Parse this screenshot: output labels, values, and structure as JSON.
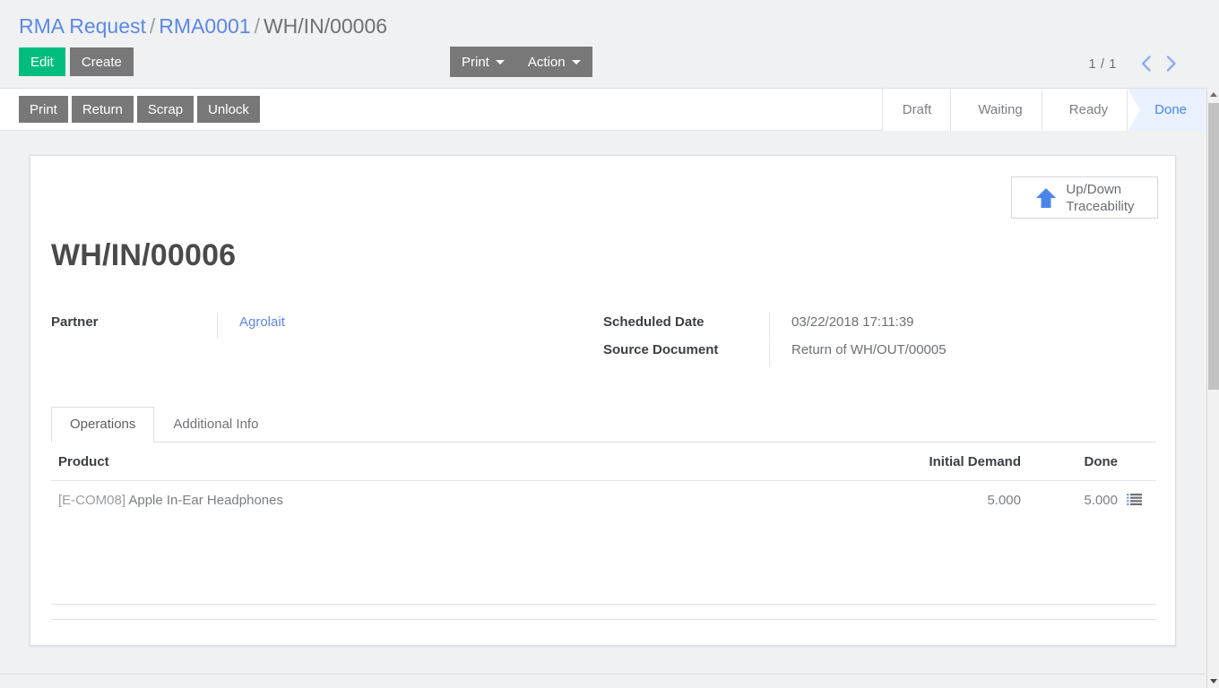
{
  "breadcrumb": {
    "items": [
      {
        "label": "RMA Request",
        "link": true
      },
      {
        "label": "RMA0001",
        "link": true
      },
      {
        "label": "WH/IN/00006",
        "link": false
      }
    ],
    "separator": "/"
  },
  "control_panel": {
    "edit_label": "Edit",
    "create_label": "Create",
    "print_label": "Print",
    "action_label": "Action",
    "pager_count": "1 / 1",
    "prev_icon": "chevron-left-icon",
    "next_icon": "chevron-right-icon"
  },
  "statusbar_buttons": [
    {
      "label": "Print"
    },
    {
      "label": "Return"
    },
    {
      "label": "Scrap"
    },
    {
      "label": "Unlock"
    }
  ],
  "statusbar": {
    "states": [
      {
        "label": "Draft",
        "active": false
      },
      {
        "label": "Waiting",
        "active": false
      },
      {
        "label": "Ready",
        "active": false
      },
      {
        "label": "Done",
        "active": true
      }
    ],
    "active_color": "#4a86e8",
    "active_bg": "#e8f1fd"
  },
  "sheet": {
    "title": "WH/IN/00006",
    "traceability_button": {
      "label_line1": "Up/Down",
      "label_line2": "Traceability",
      "icon": "arrow-up-icon",
      "icon_color": "#4a86e8"
    },
    "fields_left": [
      {
        "label": "Partner",
        "value": "Agrolait",
        "is_link": true
      }
    ],
    "fields_right": [
      {
        "label": "Scheduled Date",
        "value": "03/22/2018 17:11:39",
        "is_link": false
      },
      {
        "label": "Source Document",
        "value": "Return of WH/OUT/00005",
        "is_link": false
      }
    ],
    "tabs": [
      {
        "label": "Operations",
        "active": true
      },
      {
        "label": "Additional Info",
        "active": false
      }
    ],
    "operations_table": {
      "headers": {
        "product": "Product",
        "initial_demand": "Initial Demand",
        "done": "Done"
      },
      "rows": [
        {
          "product_code": "[E-COM08]",
          "product_name": "Apple In-Ear Headphones",
          "initial_demand": "5.000",
          "done": "5.000",
          "detail_icon": "list-icon"
        }
      ]
    }
  },
  "scrollbar": {
    "up_icon": "scroll-up-arrow-icon",
    "down_icon": "scroll-down-arrow-icon"
  }
}
